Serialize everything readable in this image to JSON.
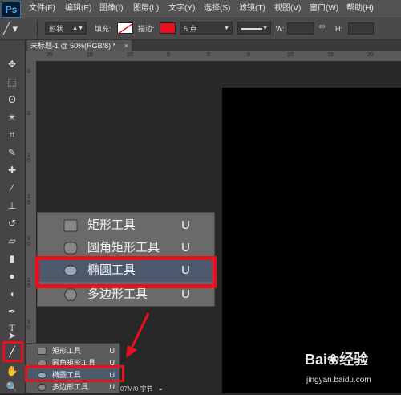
{
  "app": {
    "logo": "Ps"
  },
  "menu": [
    "文件(F)",
    "编辑(E)",
    "图像(I)",
    "图层(L)",
    "文字(Y)",
    "选择(S)",
    "滤镜(T)",
    "视图(V)",
    "窗口(W)",
    "帮助(H)"
  ],
  "options": {
    "mode_value": "形状",
    "fill_label": "填充:",
    "stroke_label": "描边:",
    "stroke_color": "#e8101d",
    "stroke_width": "5 点",
    "w_label": "W:",
    "h_label": "H:"
  },
  "document": {
    "tab_title": "未标题-1 @ 50%(RGB/8) *",
    "close": "×"
  },
  "rulers": {
    "top": [
      "20",
      "15",
      "10",
      "5",
      "0",
      "5",
      "10",
      "15",
      "20"
    ],
    "left": [
      "0",
      "5",
      "1 0",
      "1 5",
      "2 0",
      "2 5",
      "3 0"
    ]
  },
  "shape_menu_large": [
    {
      "label": "矩形工具",
      "key": "U",
      "icon": "rectangle-icon"
    },
    {
      "label": "圆角矩形工具",
      "key": "U",
      "icon": "rounded-rect-icon"
    },
    {
      "label": "椭圆工具",
      "key": "U",
      "icon": "ellipse-icon",
      "selected": true
    },
    {
      "label": "多边形工具",
      "key": "U",
      "icon": "polygon-icon"
    }
  ],
  "shape_menu_small": [
    {
      "label": "矩形工具",
      "key": "U"
    },
    {
      "label": "圆角矩形工具",
      "key": "U"
    },
    {
      "label": "椭圆工具",
      "key": "U",
      "selected": true
    },
    {
      "label": "多边形工具",
      "key": "U"
    }
  ],
  "status": {
    "text": "07M/0 字节"
  },
  "watermark": {
    "brand": "Bai",
    "brand2": "经验",
    "url": "jingyan.baidu.com"
  },
  "colors": {
    "highlight": "#e8101d",
    "selected_row": "#4d5a6e"
  }
}
